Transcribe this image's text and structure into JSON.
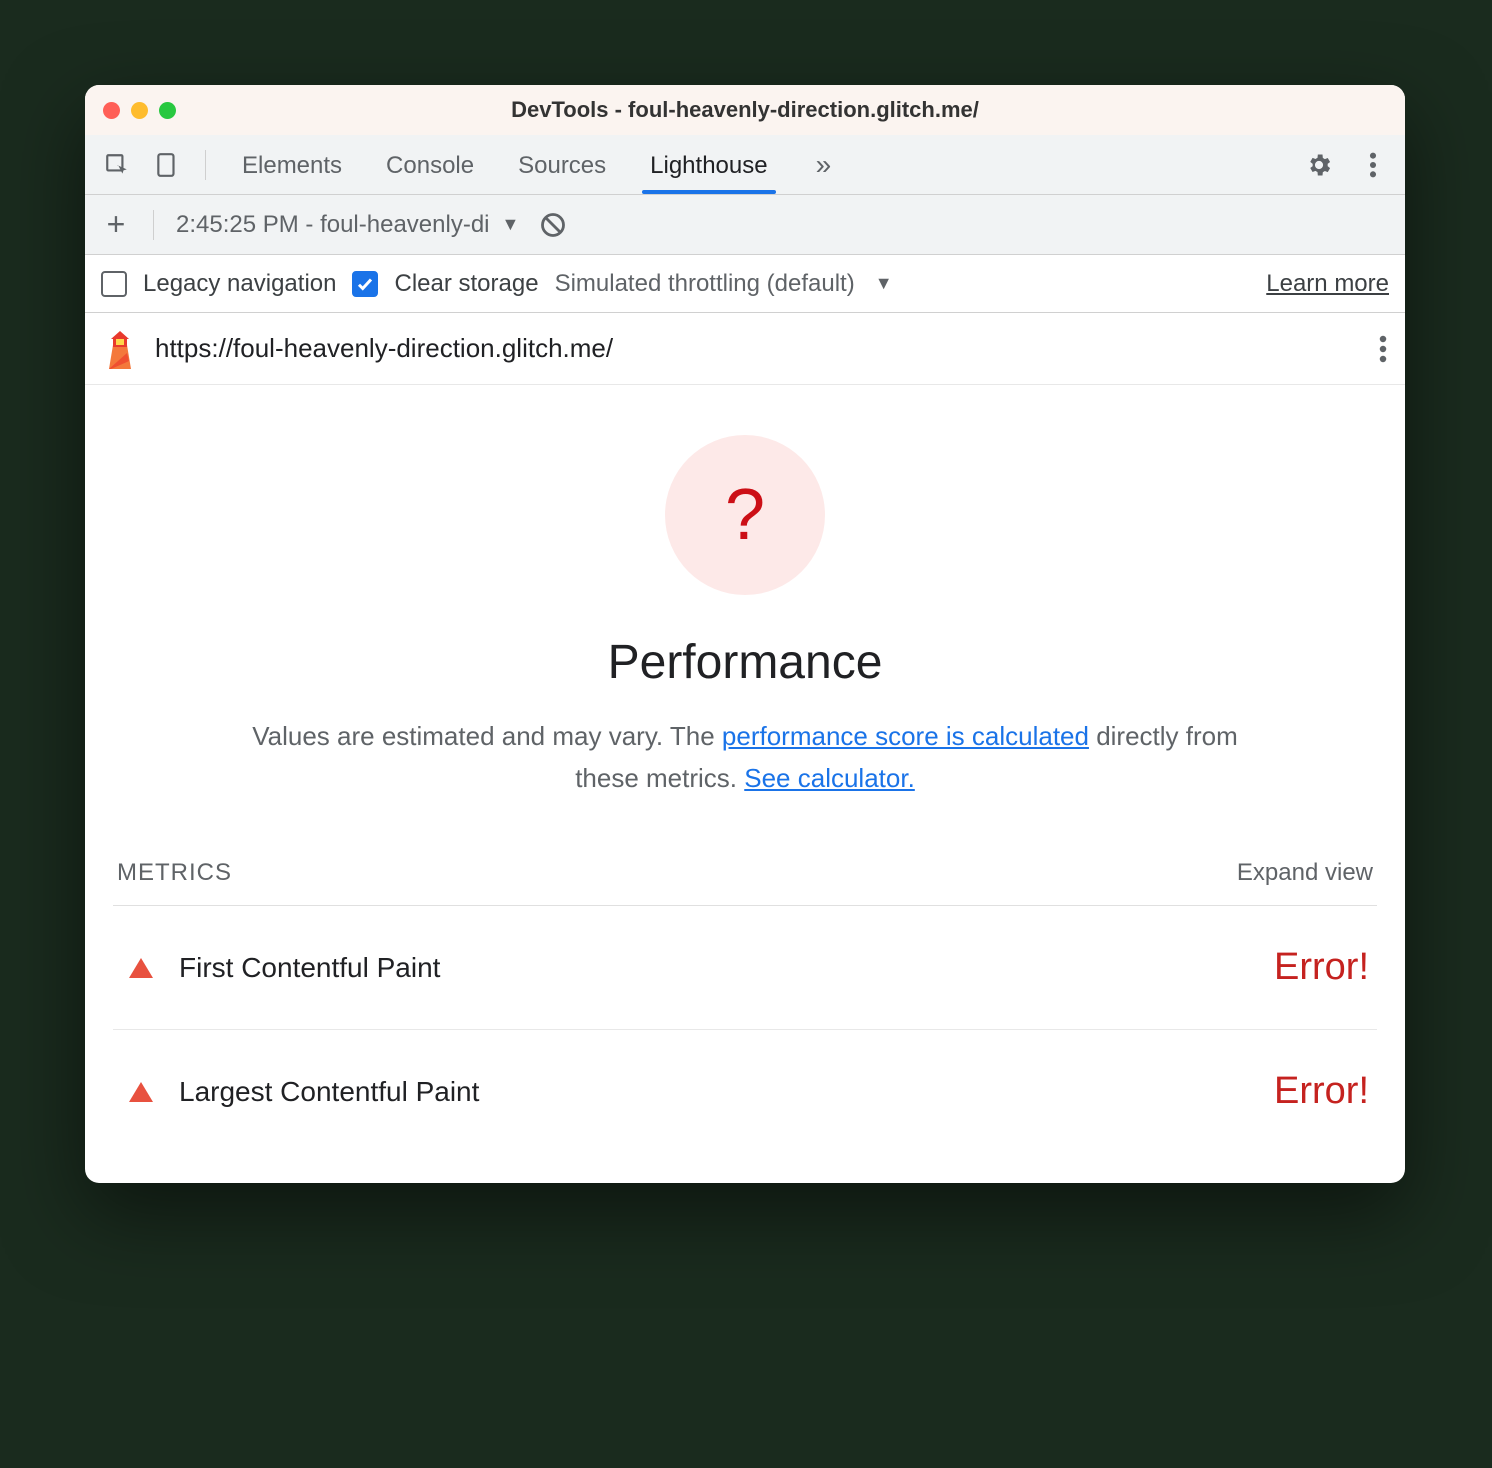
{
  "window": {
    "title": "DevTools - foul-heavenly-direction.glitch.me/"
  },
  "tabs": {
    "items": [
      "Elements",
      "Console",
      "Sources",
      "Lighthouse"
    ],
    "active": "Lighthouse"
  },
  "report_selector": {
    "label": "2:45:25 PM - foul-heavenly-di"
  },
  "options": {
    "legacy_label": "Legacy navigation",
    "legacy_checked": false,
    "clear_label": "Clear storage",
    "clear_checked": true,
    "throttling_label": "Simulated throttling (default)",
    "learn_more": "Learn more"
  },
  "url_row": {
    "url": "https://foul-heavenly-direction.glitch.me/"
  },
  "performance": {
    "score_symbol": "?",
    "title": "Performance",
    "desc_prefix": "Values are estimated and may vary. The ",
    "link1": "performance score is calculated",
    "desc_mid": " directly from these metrics. ",
    "link2": "See calculator."
  },
  "metrics": {
    "heading": "METRICS",
    "expand": "Expand view",
    "items": [
      {
        "name": "First Contentful Paint",
        "value": "Error!"
      },
      {
        "name": "Largest Contentful Paint",
        "value": "Error!"
      }
    ]
  }
}
